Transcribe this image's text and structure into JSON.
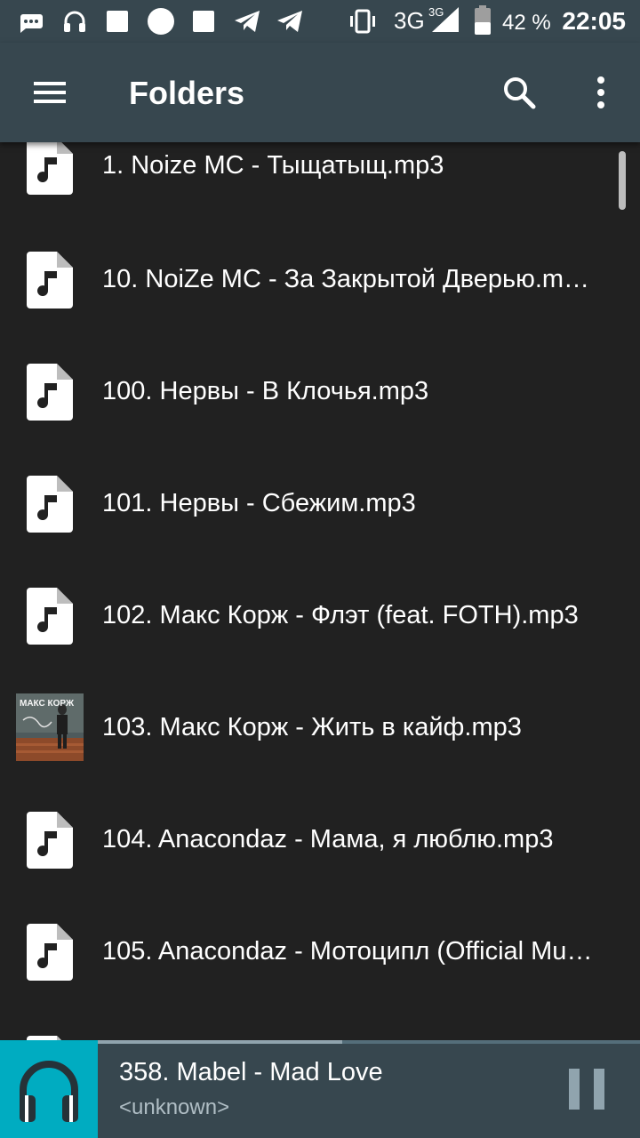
{
  "status_bar": {
    "network": "3G",
    "network_small": "3G",
    "battery": "42 %",
    "time": "22:05",
    "icons": [
      "messages-icon",
      "headphones-icon",
      "square-icon",
      "circle-icon",
      "square-icon",
      "telegram-icon",
      "telegram-icon",
      "vibrate-icon",
      "signal-icon",
      "battery-icon"
    ]
  },
  "toolbar": {
    "title": "Folders",
    "icons": [
      "menu-icon",
      "search-icon",
      "more-vert-icon"
    ]
  },
  "files": [
    {
      "label": "1. Noize MC - Тыщатыщ.mp3",
      "icon": "music-file-icon"
    },
    {
      "label": "10. NoiZe MC - За Закрытой Дверью.m…",
      "icon": "music-file-icon"
    },
    {
      "label": "100. Нервы - В Клочья.mp3",
      "icon": "music-file-icon"
    },
    {
      "label": "101. Нервы - Сбежим.mp3",
      "icon": "music-file-icon"
    },
    {
      "label": "102. Макс Корж - Флэт (feat. FOTH).mp3",
      "icon": "music-file-icon"
    },
    {
      "label": "103. Макс Корж - Жить в кайф.mp3",
      "icon": "album-art-thumbnail",
      "thumb_text": "МАКС КОРЖ"
    },
    {
      "label": "104. Anacondaz - Мама, я люблю.mp3",
      "icon": "music-file-icon"
    },
    {
      "label": "105. Anacondaz - Мотоципл (Official Mu…",
      "icon": "music-file-icon"
    }
  ],
  "player": {
    "title": "358. Mabel - Mad Love",
    "artist": "<unknown>",
    "progress": 0.45,
    "icons": [
      "headphones-icon",
      "pause-icon"
    ]
  },
  "colors": {
    "background": "#212121",
    "toolbar": "#37474f",
    "player_cover": "#00acc1"
  }
}
